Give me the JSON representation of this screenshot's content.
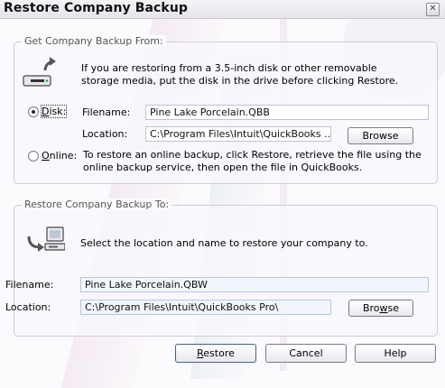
{
  "window": {
    "title": "Restore Company Backup",
    "close_glyph": "✕"
  },
  "source_group": {
    "legend": "Get Company Backup From:",
    "icon": "disk-drive-with-arrow-icon",
    "intro": "If you are restoring from a 3.5-inch disk or other removable storage media, put the disk in the drive before clicking Restore.",
    "disk_option": {
      "label_prefix": "",
      "mnemonic": "D",
      "label_rest": "isk:",
      "selected": true
    },
    "filename_label": "Filename:",
    "filename_value": "Pine Lake Porcelain.QBB",
    "location_label": "Location:",
    "location_value": "C:\\Program Files\\Intuit\\QuickBooks ...",
    "browse_label": "Browse",
    "online_option": {
      "mnemonic": "O",
      "label_rest": "nline:",
      "selected": false
    },
    "online_text": "To restore an online backup, click Restore, retrieve the file using the online backup service, then open the file in QuickBooks."
  },
  "dest_group": {
    "legend": "Restore Company Backup To:",
    "icon": "arrow-to-computer-icon",
    "intro": "Select the location and name to restore your company to."
  },
  "destination": {
    "filename_label": "Filename:",
    "filename_value": "Pine Lake Porcelain.QBW",
    "location_label": "Location:",
    "location_value": "C:\\Program Files\\Intuit\\QuickBooks Pro\\",
    "browse_prefix": "Bro",
    "browse_mnemonic": "w",
    "browse_rest": "se"
  },
  "footer": {
    "restore_mnemonic": "R",
    "restore_rest": "estore",
    "cancel_label": "Cancel",
    "help_label": "Help"
  },
  "colors": {
    "accent_blue": "#2e6db4",
    "field_border": "#b9c4d6"
  }
}
